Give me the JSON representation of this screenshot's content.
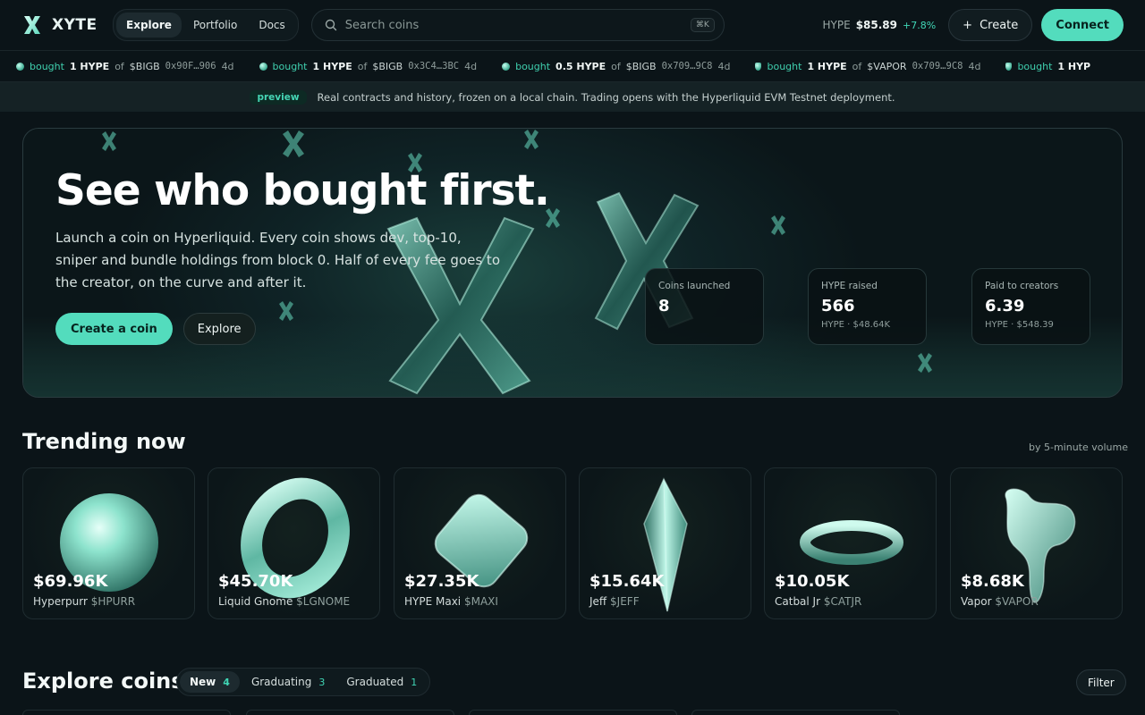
{
  "brand": {
    "name": "XYTE"
  },
  "nav": {
    "tabs": [
      {
        "label": "Explore"
      },
      {
        "label": "Portfolio"
      },
      {
        "label": "Docs"
      }
    ],
    "search_placeholder": "Search coins",
    "search_shortcut": "⌘K",
    "price": {
      "symbol": "HYPE",
      "value": "$85.89",
      "change": "+7.8%"
    },
    "create_label": "Create",
    "create_plus": "+",
    "connect_label": "Connect"
  },
  "ticker": [
    {
      "verb": "bought",
      "amount": "1 HYPE",
      "of": "of",
      "token": "$BIGB",
      "address": "0x90F…906",
      "age": "4d"
    },
    {
      "verb": "bought",
      "amount": "1 HYPE",
      "of": "of",
      "token": "$BIGB",
      "address": "0x3C4…3BC",
      "age": "4d"
    },
    {
      "verb": "bought",
      "amount": "0.5 HYPE",
      "of": "of",
      "token": "$BIGB",
      "address": "0x709…9C8",
      "age": "4d"
    },
    {
      "verb": "bought",
      "amount": "1 HYPE",
      "of": "of",
      "token": "$VAPOR",
      "address": "0x709…9C8",
      "age": "4d"
    },
    {
      "verb": "bought",
      "amount": "1 HYP",
      "of": "",
      "token": "",
      "address": "",
      "age": ""
    }
  ],
  "banner": {
    "badge": "preview",
    "text": "Real contracts and history, frozen on a local chain. Trading opens with the Hyperliquid EVM Testnet deployment."
  },
  "hero": {
    "title": "See who bought first.",
    "subtitle": "Launch a coin on Hyperliquid. Every coin shows dev, top-10, sniper and bundle holdings from block 0. Half of every fee goes to the creator, on the curve and after it.",
    "primary_cta": "Create a coin",
    "secondary_cta": "Explore",
    "stats": [
      {
        "label": "Coins launched",
        "value": "8",
        "sub": ""
      },
      {
        "label": "HYPE raised",
        "value": "566",
        "sub": "HYPE · $48.64K"
      },
      {
        "label": "Paid to creators",
        "value": "6.39",
        "sub": "HYPE · $548.39"
      }
    ]
  },
  "trending": {
    "title": "Trending now",
    "note": "by 5-minute volume",
    "coins": [
      {
        "mcap": "$69.96K",
        "name": "Hyperpurr",
        "ticker": "$HPURR",
        "icon": "sphere-icon"
      },
      {
        "mcap": "$45.70K",
        "name": "Liquid Gnome",
        "ticker": "$LGNOME",
        "icon": "ring-icon"
      },
      {
        "mcap": "$27.35K",
        "name": "HYPE Maxi",
        "ticker": "$MAXI",
        "icon": "cube-icon"
      },
      {
        "mcap": "$15.64K",
        "name": "Jeff",
        "ticker": "$JEFF",
        "icon": "crystal-icon"
      },
      {
        "mcap": "$10.05K",
        "name": "Catbal Jr",
        "ticker": "$CATJR",
        "icon": "torus-icon"
      },
      {
        "mcap": "$8.68K",
        "name": "Vapor",
        "ticker": "$VAPOR",
        "icon": "drip-icon"
      }
    ]
  },
  "explore": {
    "title": "Explore coins",
    "tabs": [
      {
        "label": "New",
        "count": "4"
      },
      {
        "label": "Graduating",
        "count": "3"
      },
      {
        "label": "Graduated",
        "count": "1"
      }
    ],
    "filter_label": "Filter"
  },
  "colors": {
    "accent": "#53dcbd",
    "background": "#0b1418",
    "positive": "#40d6b5"
  }
}
